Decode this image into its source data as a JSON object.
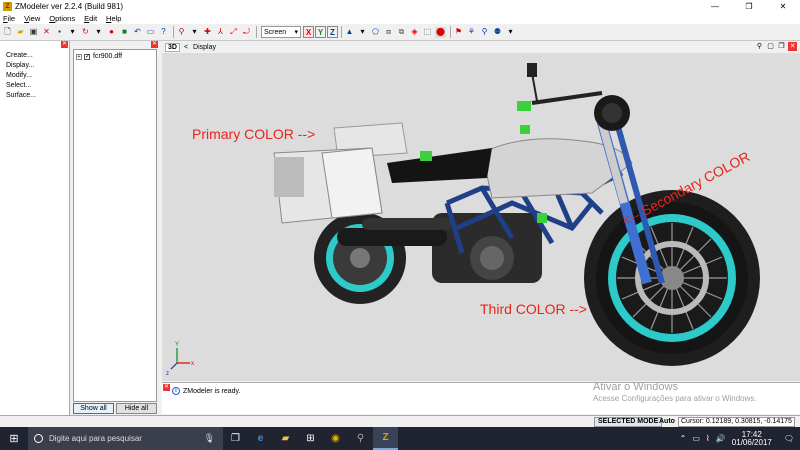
{
  "window": {
    "title": "ZModeler ver 2.2.4 (Build 981)",
    "app_icon": "Z",
    "controls": [
      "—",
      "❐",
      "✕"
    ]
  },
  "menu": [
    "File",
    "View",
    "Options",
    "Edit",
    "Help"
  ],
  "toolbar": {
    "coord_mode": "Screen",
    "axes": [
      "X",
      "Y",
      "Z"
    ]
  },
  "commands": [
    "Create...",
    "Display...",
    "Modify...",
    "Select...",
    "Surface..."
  ],
  "hierarchy": {
    "items": [
      {
        "label": "fcr900.dff",
        "checked": true
      }
    ],
    "show_all": "Show all",
    "hide_all": "Hide all"
  },
  "viewport": {
    "mode": "3D",
    "title": "Display"
  },
  "annotations": {
    "primary": "Primary COLOR -->",
    "secondary": "<-- Secondary COLOR",
    "third": "Third COLOR -->"
  },
  "log": {
    "message": "ZModeler is ready."
  },
  "watermark": {
    "line1": "Ativar o Windows",
    "line2": "Acesse Configurações para ativar o Windows."
  },
  "status": {
    "mode": "SELECTED MODE",
    "auto": "Auto",
    "cursor": "Cursor: 0.12189, 0.30815, -0.14175"
  },
  "taskbar": {
    "search_placeholder": "Digite aqui para pesquisar",
    "time": "17:42",
    "date": "01/06/2017"
  },
  "colors": {
    "annotation": "#e8241e",
    "primary_body": "#e6e6e6",
    "secondary_fork": "#3f6fd0",
    "third_rim": "#2ec9c9",
    "frame": "#1f3f86",
    "accent_green": "#3ad13a"
  }
}
